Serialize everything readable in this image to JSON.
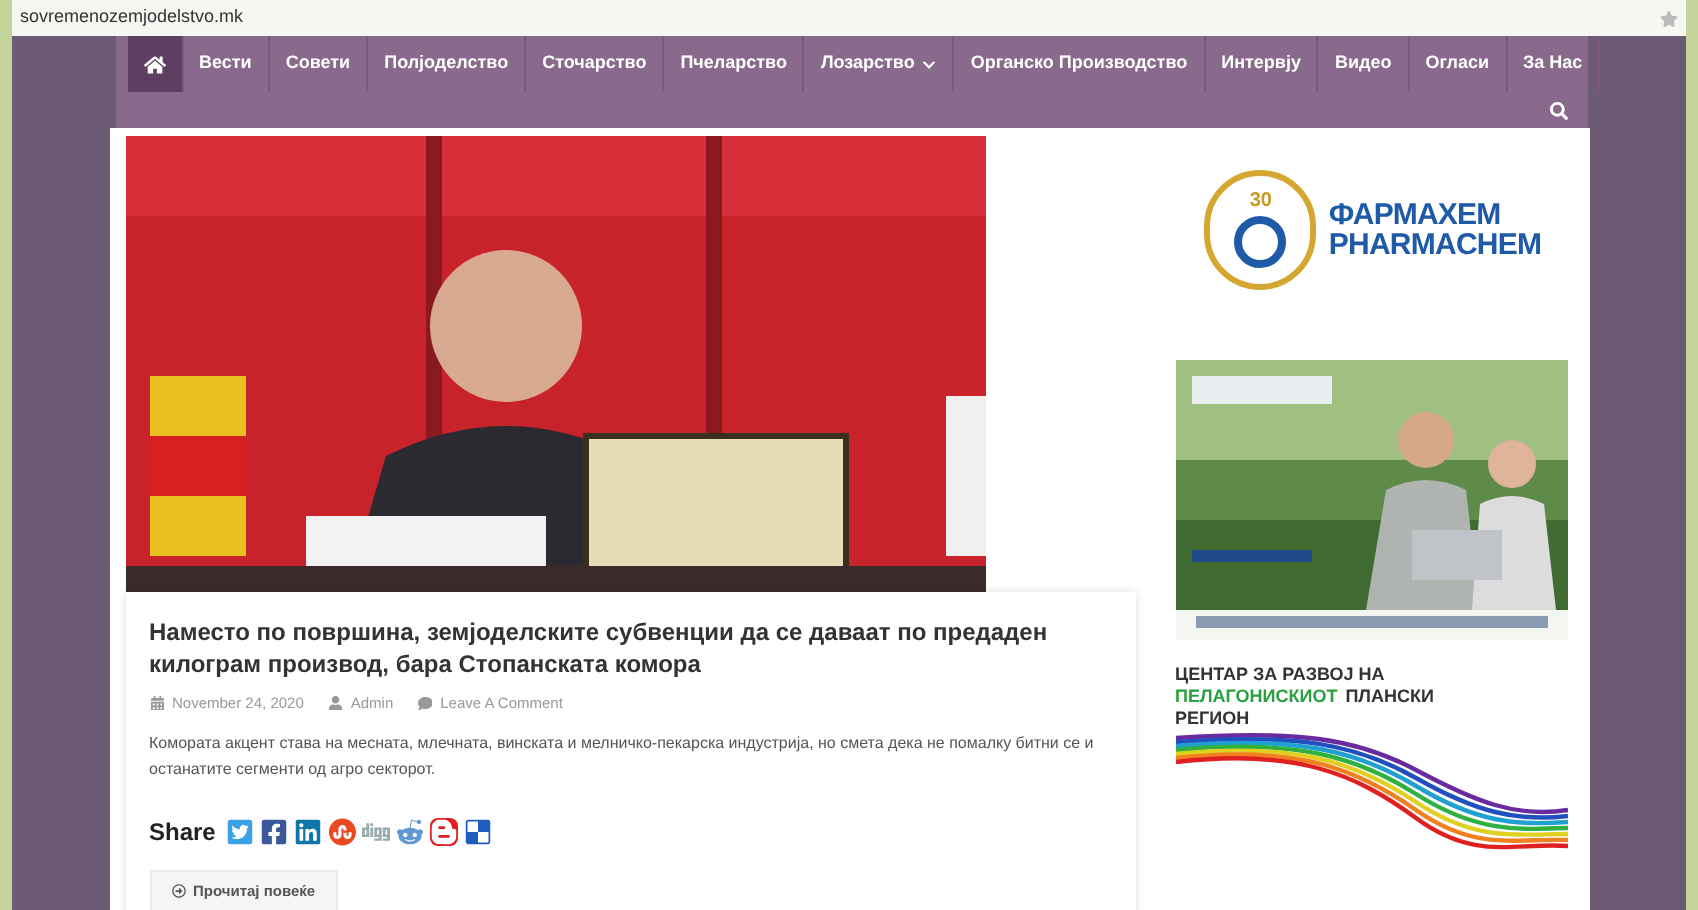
{
  "address_bar": {
    "url": "sovremenozemjodelstvo.mk"
  },
  "nav": {
    "items": [
      {
        "kind": "home",
        "selected": true
      },
      {
        "label": "Вести",
        "selected": false
      },
      {
        "label": "Совети",
        "selected": false
      },
      {
        "label": "Полјоделство",
        "selected": false
      },
      {
        "label": "Сточарство",
        "selected": false
      },
      {
        "label": "Пчеларство",
        "selected": false
      },
      {
        "label": "Лозарство",
        "selected": false,
        "dropdown": true
      },
      {
        "label": "Органско Производство",
        "selected": false
      },
      {
        "label": "Интервју",
        "selected": false
      },
      {
        "label": "Видео",
        "selected": false
      },
      {
        "label": "Огласи",
        "selected": false
      },
      {
        "label": "За Нас",
        "selected": false
      }
    ]
  },
  "article": {
    "title": "Наместо по површина, земјоделските субвенции да се даваат по предаден килограм производ, бара Стопанската комора",
    "date": "November 24, 2020",
    "author": "Admin",
    "comments": "Leave A Comment",
    "excerpt": "Комората акцент става на месната, млечната, винската и мелничко-пекарска индустрија, но смета дека не помалку битни се и останатите сегменти од агро секторот.",
    "share_label": "Share",
    "share_icons": [
      {
        "kind": "twitter"
      },
      {
        "kind": "facebook"
      },
      {
        "kind": "linkedin"
      },
      {
        "kind": "stumbleupon"
      },
      {
        "kind": "digg"
      },
      {
        "kind": "reddit"
      },
      {
        "kind": "blogger"
      },
      {
        "kind": "delicious"
      }
    ],
    "read_more": "Прочитај повеќе"
  },
  "sidebar": {
    "logo": {
      "badge": "30",
      "name_cyrillic": "ФАРМАХЕМ",
      "name_latin": "PHARMACHEM"
    },
    "region": {
      "line_1": "ЦЕНТАР ЗА РАЗВОЈ НА",
      "highlight": "ПЕЛАГОНИСКИОТ",
      "line_2_rest": "ПЛАНСКИ",
      "line_3": "РЕГИОН"
    }
  }
}
